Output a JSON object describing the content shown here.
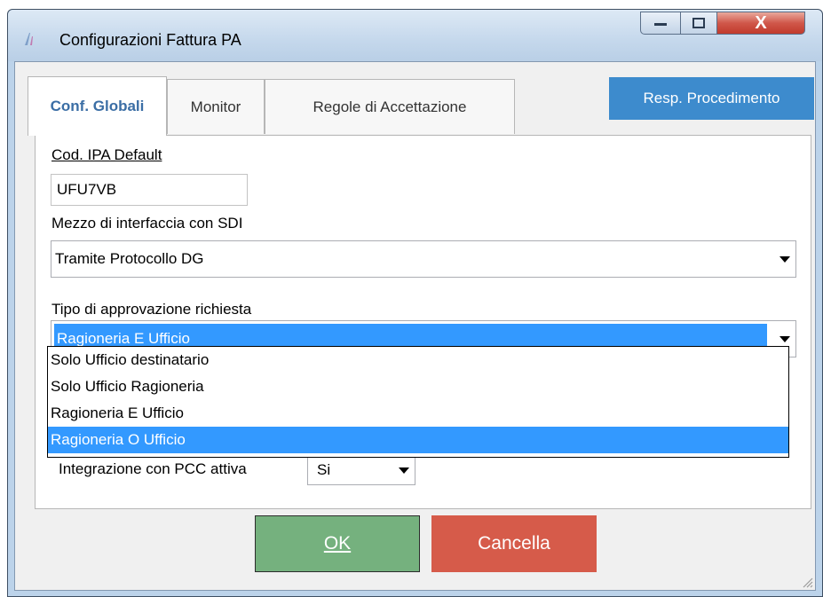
{
  "window": {
    "title": "Configurazioni Fattura PA",
    "close_glyph": "X"
  },
  "tabs": [
    {
      "label": "Conf. Globali"
    },
    {
      "label": "Monitor"
    },
    {
      "label": "Regole di Accettazione"
    }
  ],
  "resp_button": {
    "label": "Resp. Procedimento"
  },
  "form": {
    "cod_ipa_label": "Cod. IPA Default",
    "cod_ipa_value": "UFU7VB",
    "mezzo_label": "Mezzo di interfaccia con SDI",
    "mezzo_value": "Tramite Protocollo DG",
    "tipo_label": "Tipo di approvazione richiesta",
    "tipo_value": "Ragioneria E Ufficio",
    "tipo_options": [
      "Solo Ufficio destinatario",
      "Solo Ufficio Ragioneria",
      "Ragioneria E Ufficio",
      "Ragioneria O Ufficio"
    ],
    "pcc_label": "Integrazione con PCC attiva",
    "pcc_value": "Si"
  },
  "buttons": {
    "ok_label": "OK",
    "cancel_label": "Cancella"
  },
  "colors": {
    "accent": "#3d8bcd",
    "ok": "#75b17e",
    "cancel": "#d65b4a",
    "selection": "#3399ff"
  }
}
